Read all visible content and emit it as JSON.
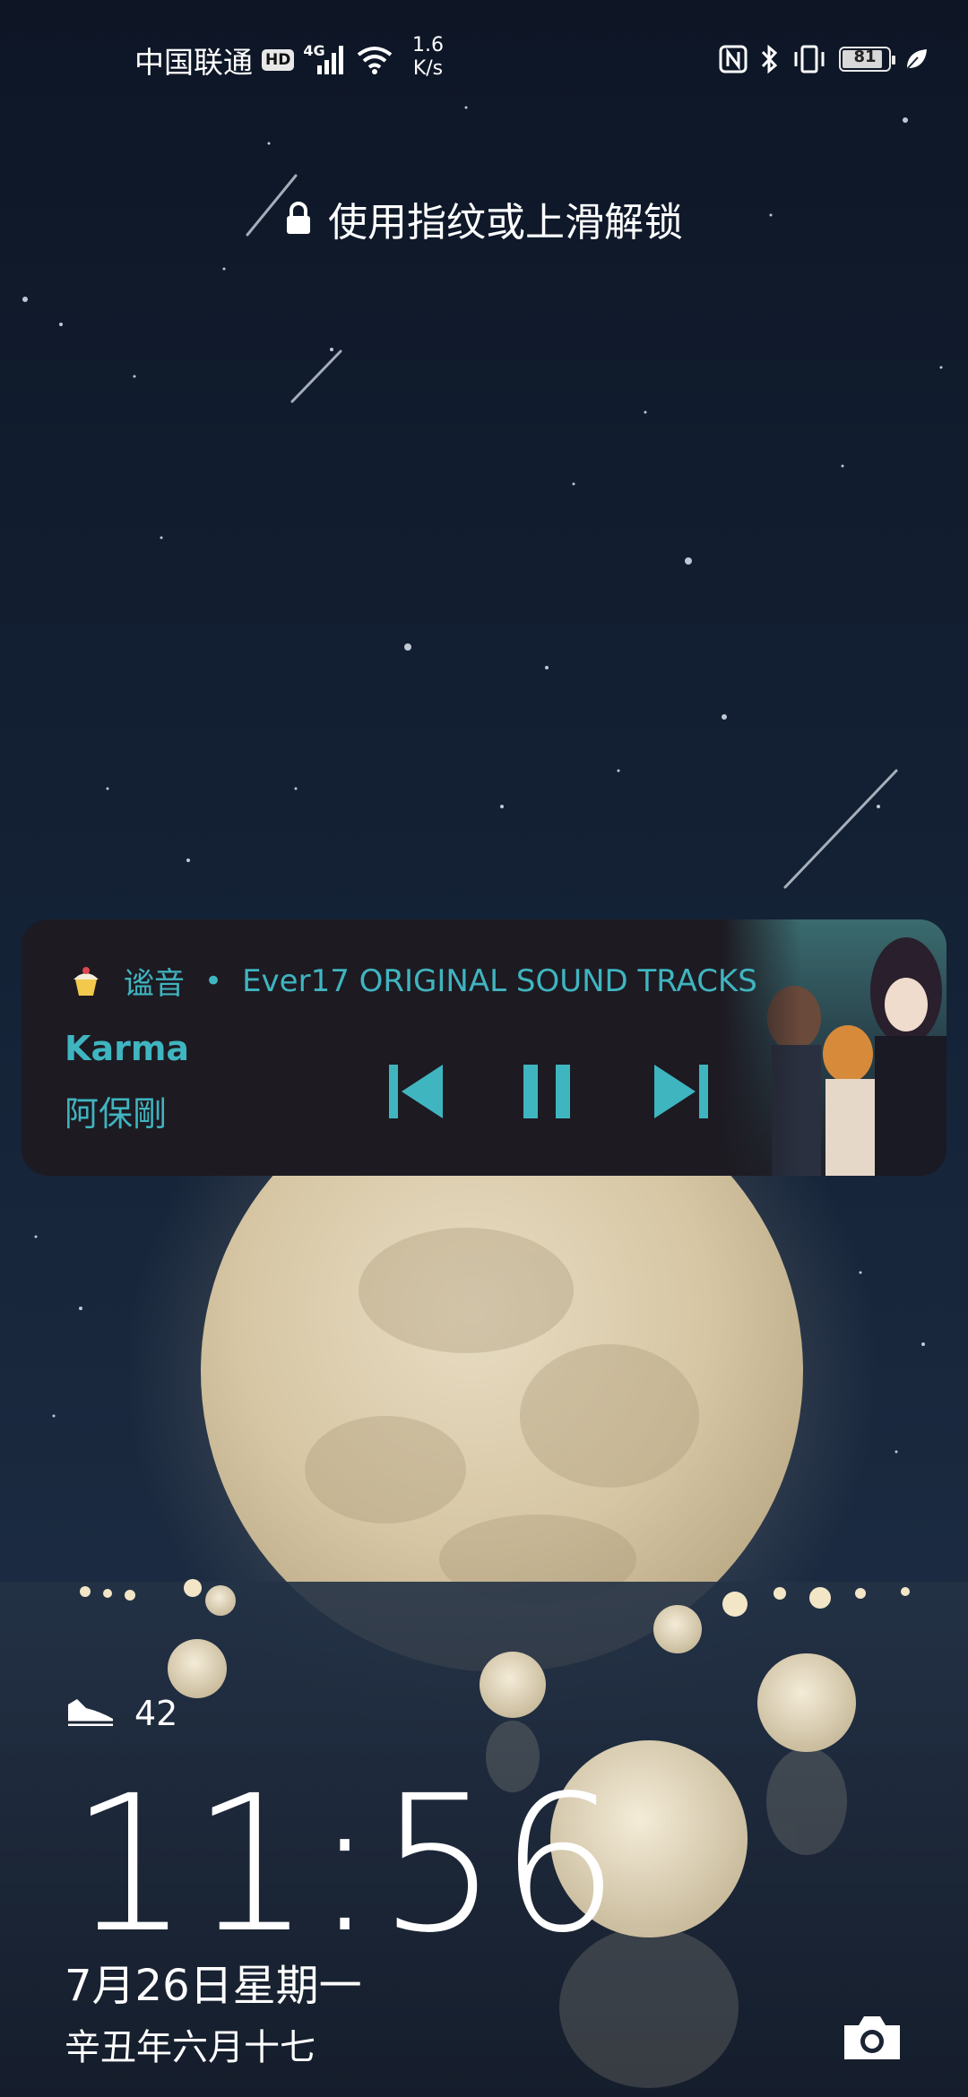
{
  "status_bar": {
    "carrier": "中国联通",
    "hd_badge": "HD",
    "network_type": "4G",
    "speed_value": "1.6",
    "speed_unit": "K/s",
    "battery_level": "81",
    "icons": [
      "hd-icon",
      "signal-icon",
      "wifi-icon",
      "nfc-icon",
      "bluetooth-icon",
      "vibrate-icon",
      "battery-icon",
      "leaf-icon"
    ]
  },
  "unlock_hint": {
    "icon": "lock-icon",
    "text": "使用指纹或上滑解锁"
  },
  "music": {
    "app_name": "谧音",
    "separator": "•",
    "album": "Ever17 ORIGINAL SOUND TRACKS",
    "title": "Karma",
    "artist": "阿保剛",
    "controls": [
      "previous-icon",
      "pause-icon",
      "next-icon"
    ],
    "accent": "#3fb5c0"
  },
  "steps": {
    "icon": "shoe-icon",
    "count": "42"
  },
  "clock": {
    "time": "11:56",
    "date": "7月26日星期一",
    "lunar_date": "辛丑年六月十七"
  },
  "shortcut": {
    "icon": "camera-icon"
  }
}
